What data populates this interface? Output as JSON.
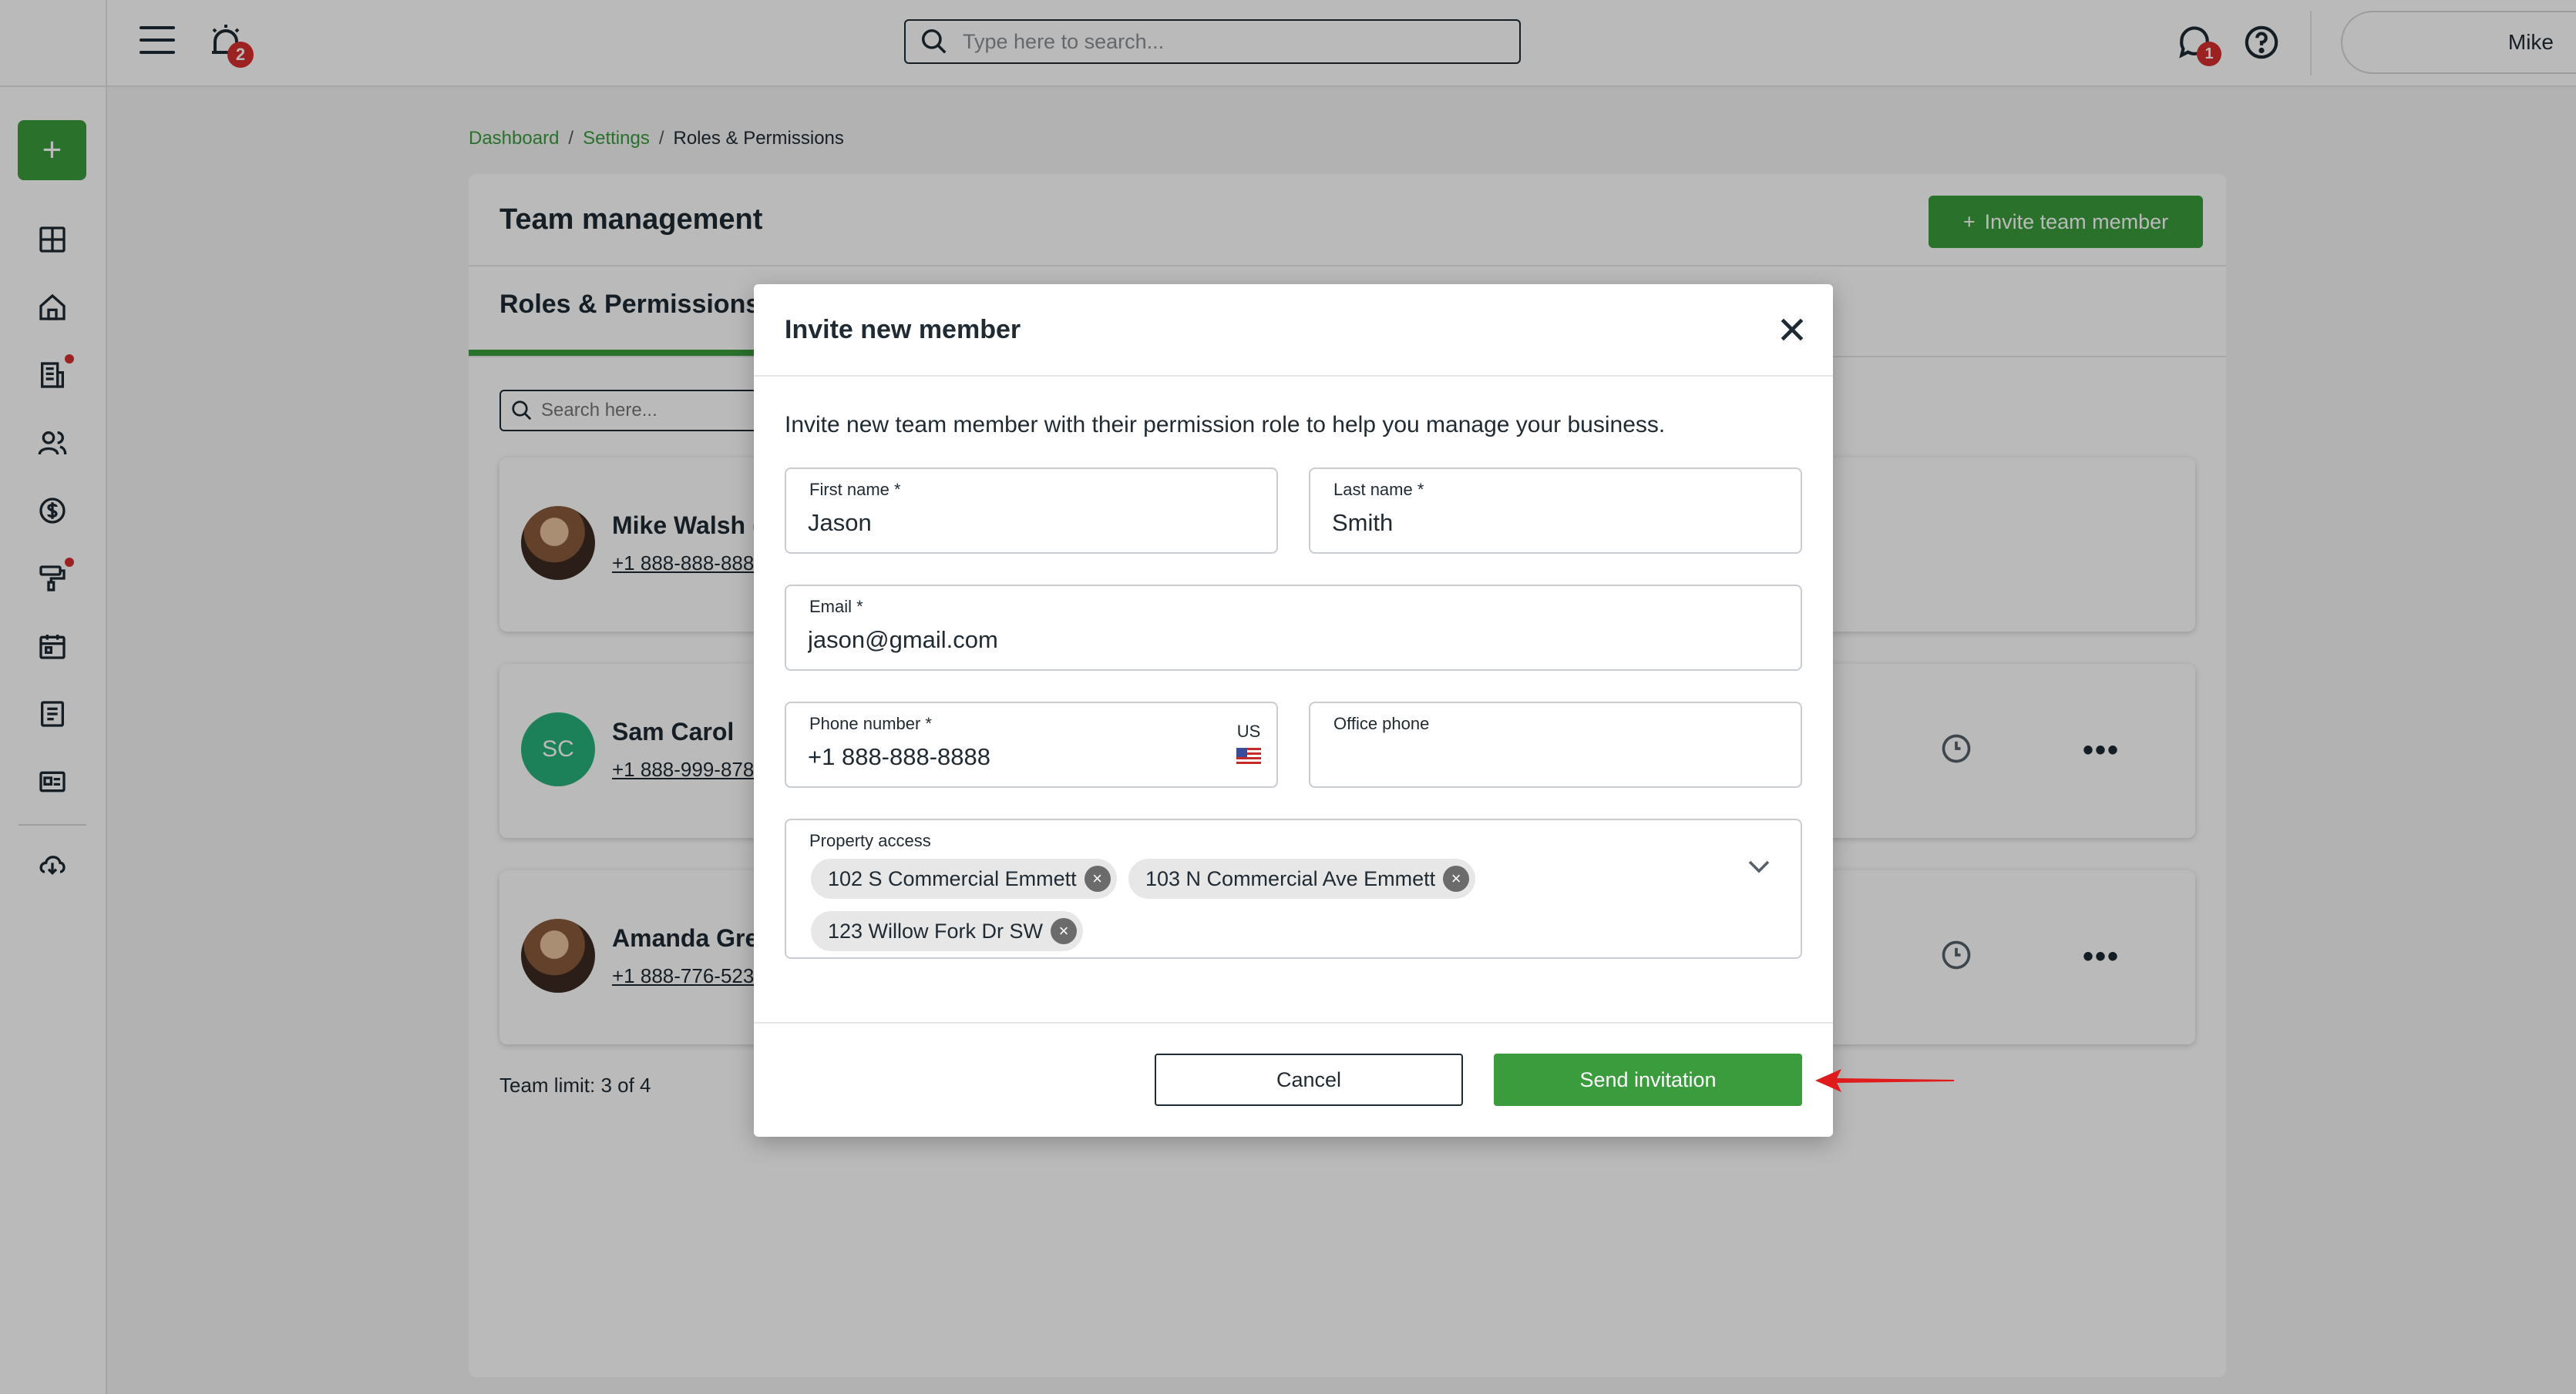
{
  "topbar": {
    "alarm_badge": "2",
    "search_placeholder": "Type here to search...",
    "chat_badge": "1",
    "user_name": "Mike"
  },
  "breadcrumb": {
    "items": [
      "Dashboard",
      "Settings",
      "Roles & Permissions"
    ]
  },
  "panel": {
    "title": "Team management",
    "invite_label": "Invite team member",
    "tab_active": "Roles & Permissions",
    "search_placeholder": "Search here...",
    "members": [
      {
        "name": "Mike Walsh (",
        "phone": "+1 888-888-888"
      },
      {
        "initials": "SC",
        "name": "Sam Carol",
        "phone": "+1 888-999-878"
      },
      {
        "name": "Amanda Gre",
        "phone": "+1 888-776-523"
      }
    ],
    "team_limit": "Team limit: 3 of 4"
  },
  "modal": {
    "title": "Invite new member",
    "description": "Invite new team member with their permission role to help you manage your business.",
    "first_name": {
      "label": "First name *",
      "value": "Jason"
    },
    "last_name": {
      "label": "Last name *",
      "value": "Smith"
    },
    "email": {
      "label": "Email *",
      "value": "jason@gmail.com"
    },
    "phone": {
      "label": "Phone number *",
      "value": "+1 888-888-8888",
      "country": "US"
    },
    "office_phone": {
      "label": "Office phone",
      "value": ""
    },
    "property_access": {
      "label": "Property access",
      "chips": [
        "102 S Commercial Emmett",
        "103 N Commercial Ave Emmett",
        "123 Willow Fork Dr SW"
      ]
    },
    "cancel_label": "Cancel",
    "send_label": "Send invitation"
  },
  "colors": {
    "brand_green": "#3a9c3c",
    "badge_red": "#d62f2f",
    "annotation_arrow": "#e01b1b"
  }
}
